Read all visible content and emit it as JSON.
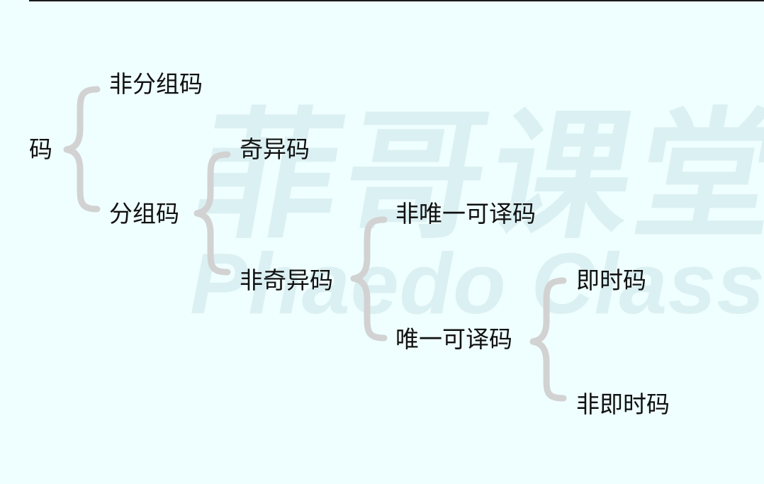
{
  "watermark": {
    "cn": "菲哥课堂",
    "en": "Phaedo Classes"
  },
  "nodes": {
    "root": "码",
    "non_block": "非分组码",
    "block": "分组码",
    "singular": "奇异码",
    "non_singular": "非奇异码",
    "not_uniquely_decodable": "非唯一可译码",
    "uniquely_decodable": "唯一可译码",
    "instantaneous": "即时码",
    "non_instantaneous": "非即时码"
  }
}
